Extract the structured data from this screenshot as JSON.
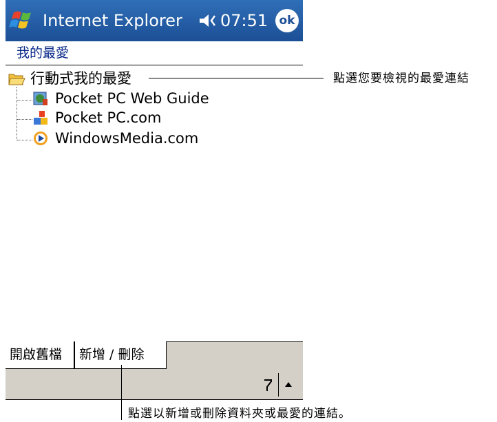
{
  "titlebar": {
    "app_title": "Internet Explorer",
    "clock": "07:51",
    "ok_label": "ok",
    "icons": [
      "windows-start-icon",
      "volume-icon"
    ]
  },
  "breadcrumb": "我的最愛",
  "tree": {
    "folder_label": "行動式我的最愛",
    "items": [
      {
        "label": "Pocket PC Web Guide",
        "icon": "web-guide-icon"
      },
      {
        "label": "Pocket PC.com",
        "icon": "pocketpc-icon"
      },
      {
        "label": "WindowsMedia.com",
        "icon": "windows-media-icon"
      }
    ]
  },
  "tabs": [
    {
      "label": "開啟舊檔"
    },
    {
      "label": "新增 / 刪除"
    }
  ],
  "callouts": {
    "top": "點選您要檢視的最愛連結",
    "bottom": "點選以新增或刪除資料夾或最愛的連結。"
  },
  "colors": {
    "titlebar": "#1c4f95",
    "breadcrumb": "#0a2a8a",
    "toolbar": "#d4d0c8"
  }
}
